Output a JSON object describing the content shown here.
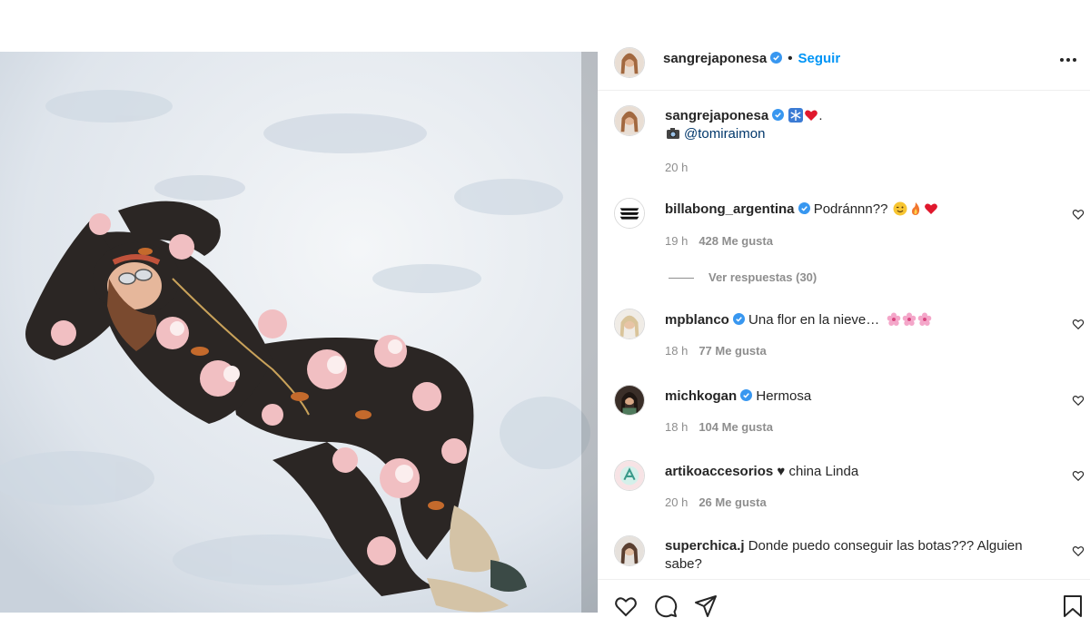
{
  "post": {
    "author": "sangrejaponesa",
    "follow_label": "Seguir",
    "dot": "•",
    "caption_period": ".",
    "credit": "@tomiraimon",
    "caption_time": "20 h"
  },
  "icons": {
    "verified": "verified-badge-icon",
    "more": "more-options-icon",
    "like": "heart-icon",
    "comment": "comment-icon",
    "share": "share-icon",
    "save": "bookmark-icon",
    "camera": "camera-icon",
    "snowflake": "snowflake-icon",
    "red_heart": "red-heart-icon",
    "flower": "cherry-blossom-icon",
    "wink": "winking-face-icon",
    "fire": "fire-icon"
  },
  "colors": {
    "accent": "#0095f6",
    "verified": "#3897f0",
    "muted": "#8e8e8e",
    "text": "#262626"
  },
  "comments": [
    {
      "user": "billabong_argentina",
      "verified": true,
      "text": "Podránnn??",
      "time": "19 h",
      "likes": "428 Me gusta",
      "replies": "Ver respuestas (30)"
    },
    {
      "user": "mpblanco",
      "verified": true,
      "text": "Una flor en la nieve…",
      "time": "18 h",
      "likes": "77 Me gusta"
    },
    {
      "user": "michkogan",
      "verified": true,
      "text": "Hermosa",
      "time": "18 h",
      "likes": "104 Me gusta"
    },
    {
      "user": "artikoaccesorios",
      "verified": false,
      "text": "♥ china Linda",
      "time": "20 h",
      "likes": "26 Me gusta"
    },
    {
      "user": "superchica.j",
      "verified": false,
      "text": "Donde puedo conseguir las botas??? Alguien sabe?"
    }
  ]
}
